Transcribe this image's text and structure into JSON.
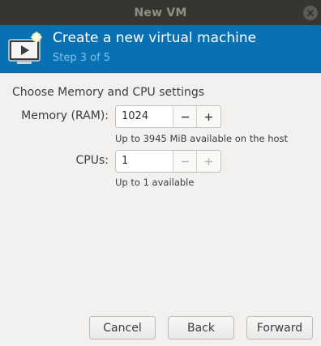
{
  "window": {
    "title": "New VM"
  },
  "header": {
    "title": "Create a new virtual machine",
    "step": "Step 3 of 5",
    "icon": "vm-screen-new-icon"
  },
  "section": {
    "title": "Choose Memory and CPU settings"
  },
  "memory": {
    "label": "Memory (RAM):",
    "value": "1024",
    "hint": "Up to 3945 MiB available on the host"
  },
  "cpus": {
    "label": "CPUs:",
    "value": "1",
    "hint": "Up to 1 available"
  },
  "buttons": {
    "cancel": "Cancel",
    "back": "Back",
    "forward": "Forward"
  },
  "colors": {
    "header_bg": "#0871b3",
    "titlebar_bg": "#36352f",
    "window_bg": "#f2f1f0"
  }
}
